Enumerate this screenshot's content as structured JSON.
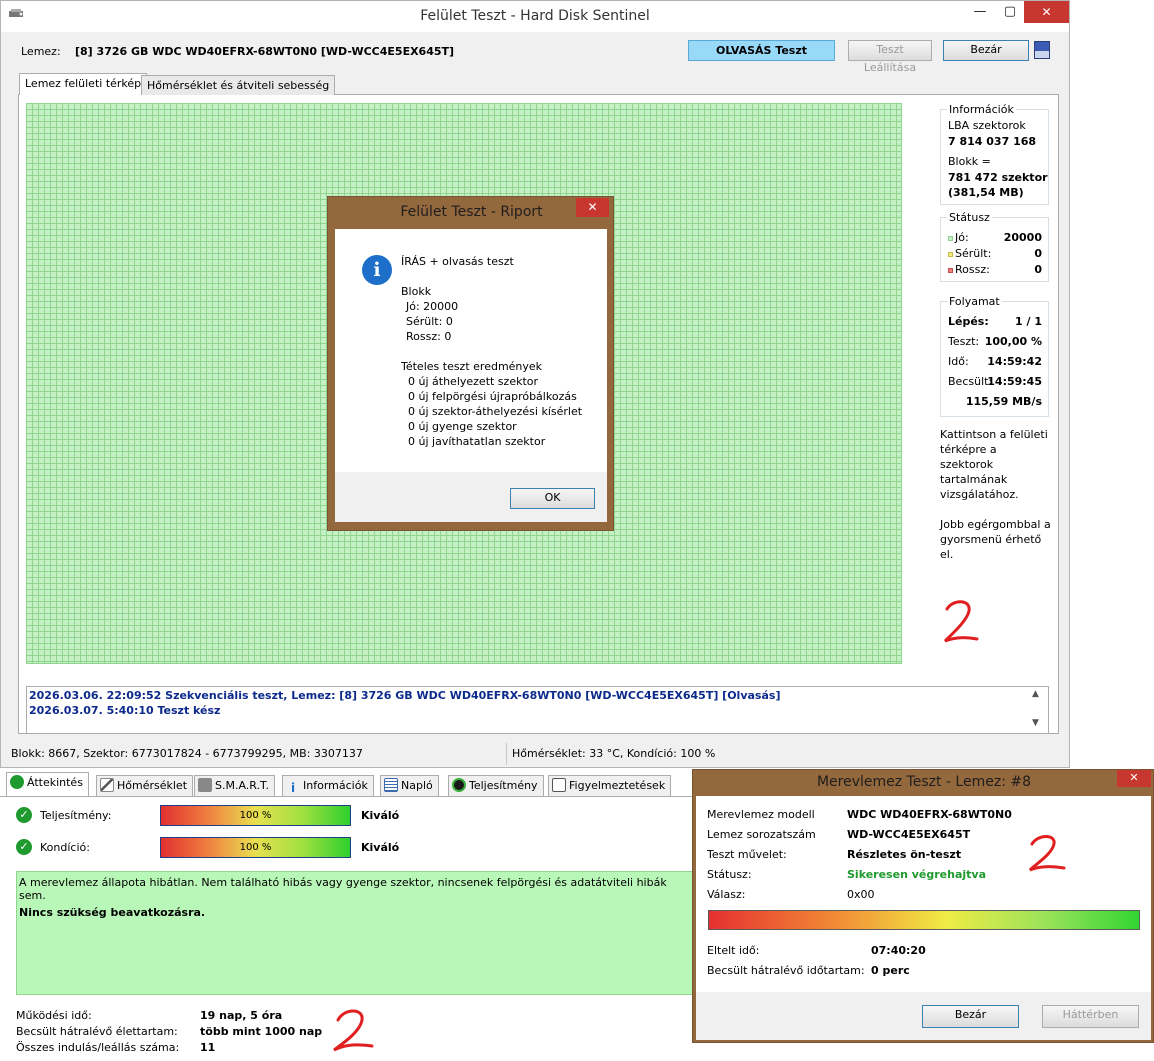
{
  "main_window": {
    "title": "Felület Teszt - Hard Disk Sentinel",
    "controls": {
      "minimize": "—",
      "maximize": "▢",
      "close": "✕"
    },
    "disk_label": "Lemez:",
    "disk_value": "[8] 3726 GB  WDC WD40EFRX-68WT0N0 [WD-WCC4E5EX645T]",
    "buttons": {
      "read_test": "OLVASÁS Teszt",
      "stop_test": "Teszt Leállítása",
      "close": "Bezár"
    },
    "tabs": [
      "Lemez felületi térkép",
      "Hőmérséklet és átviteli sebesség"
    ],
    "info": {
      "title": "Információk",
      "lba_label": "LBA szektorok",
      "lba_value": "7 814 037 168",
      "block_label": "Blokk =",
      "block_value": "781 472 szektor",
      "block_size": "(381,54 MB)"
    },
    "status": {
      "title": "Státusz",
      "good_label": "Jó:",
      "good_value": "20000",
      "damaged_label": "Sérült:",
      "damaged_value": "0",
      "bad_label": "Rossz:",
      "bad_value": "0",
      "colors": {
        "good": "#c6f0c6",
        "damaged": "#f3eb7a",
        "bad": "#f08080"
      }
    },
    "progress": {
      "title": "Folyamat",
      "step_label": "Lépés:",
      "step_value": "1 / 1",
      "test_label": "Teszt:",
      "test_value": "100,00 %",
      "time_label": "Idő:",
      "time_value": "14:59:42",
      "estimated_label": "Becsült:",
      "estimated_value": "14:59:45",
      "speed": "115,59 MB/s"
    },
    "hint_1": "Kattintson a felületi térképre a szektorok tartalmának vizsgálatához.",
    "hint_2": "Jobb egérgombbal a gyorsmenü érhető el.",
    "log": [
      "2026.03.06.  22:09:52   Szekvenciális teszt, Lemez: [8] 3726 GB  WDC WD40EFRX-68WT0N0 [WD-WCC4E5EX645T] [Olvasás]",
      "2026.03.07.  5:40:10   Teszt kész"
    ],
    "status_bar_left": "Blokk: 8667, Szektor: 6773017824 - 6773799295, MB: 3307137",
    "status_bar_right": "Hőmérséklet: 33  °C,  Kondíció: 100 %"
  },
  "report_dialog": {
    "title": "Felület Teszt - Riport",
    "close": "✕",
    "heading": "ÍRÁS + olvasás teszt",
    "block_title": "Blokk",
    "good": "Jó: 20000",
    "damaged": "Sérült: 0",
    "bad": "Rossz: 0",
    "results_title": "Tételes teszt eredmények",
    "results": [
      "0 új áthelyezett szektor",
      "0 új felpörgési újrapróbálkozás",
      "0 új szektor-áthelyezési kísérlet",
      "0 új gyenge szektor",
      "0 új javíthatatlan szektor"
    ],
    "ok": "OK"
  },
  "lower_panel": {
    "tabs": [
      "Áttekintés",
      "Hőmérséklet",
      "S.M.A.R.T.",
      "Információk",
      "Napló",
      "Teljesítmény",
      "Figyelmeztetések"
    ],
    "performance_label": "Teljesítmény:",
    "performance_percent": "100 %",
    "performance_fill": 100,
    "performance_rating": "Kiváló",
    "condition_label": "Kondíció:",
    "condition_percent": "100 %",
    "condition_fill": 100,
    "condition_rating": "Kiváló",
    "health_text": "A merevlemez állapota hibátlan. Nem található hibás vagy gyenge szektor, nincsenek felpörgési és adatátviteli hibák sem.",
    "action_text": "Nincs szükség beavatkozásra.",
    "uptime_label": "Működési idő:",
    "uptime_value": "19 nap, 5 óra",
    "remaining_label": "Becsült hátralévő élettartam:",
    "remaining_value": "több mint 1000 nap",
    "starts_label": "Összes indulás/leállás száma:",
    "starts_value": "11"
  },
  "hdd_test_dialog": {
    "title": "Merevlemez Teszt - Lemez: #8",
    "close": "✕",
    "model_label": "Merevlemez modell",
    "model_value": "WDC WD40EFRX-68WT0N0",
    "serial_label": "Lemez sorozatszám",
    "serial_value": "WD-WCC4E5EX645T",
    "operation_label": "Teszt művelet:",
    "operation_value": "Részletes ön-teszt",
    "status_label": "Státusz:",
    "status_value": "Sikeresen végrehajtva",
    "response_label": "Válasz:",
    "response_value": "0x00",
    "progress_fill": 100,
    "elapsed_label": "Eltelt idő:",
    "elapsed_value": "07:40:20",
    "remaining_label": "Becsült hátralévő időtartam:",
    "remaining_value": "0 perc",
    "close_button": "Bezár",
    "background_button": "Háttérben",
    "status_color": "#1f9a2e"
  },
  "annotation_mark": "2"
}
